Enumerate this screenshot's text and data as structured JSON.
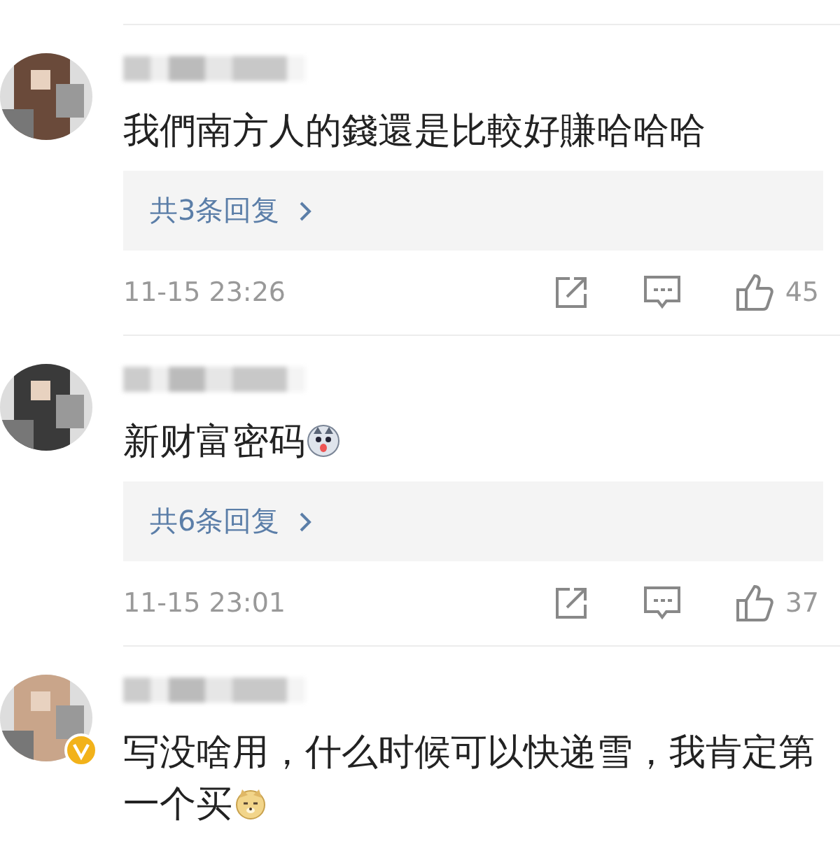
{
  "comments": [
    {
      "verified": false,
      "text": "我們南方人的錢還是比較好賺哈哈哈",
      "replies_label": "共3条回复",
      "time": "11-15 23:26",
      "likes": "45"
    },
    {
      "verified": false,
      "text": "新财富密码",
      "emoji": [
        {
          "kind": "husky"
        }
      ],
      "replies_label": "共6条回复",
      "time": "11-15 23:01",
      "likes": "37"
    },
    {
      "verified": true,
      "text_lines": [
        "写没啥用，什么时候可以快递雪，我肯定第",
        "一个买"
      ],
      "emoji": [
        {
          "kind": "doge"
        }
      ]
    }
  ]
}
